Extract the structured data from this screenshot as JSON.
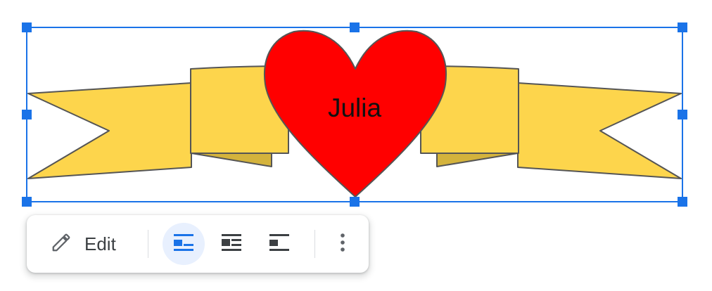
{
  "drawing": {
    "label": "Julia",
    "ribbon_color": "#fdd54c",
    "ribbon_shadow_color": "#d4b33c",
    "heart_color": "#ff0000",
    "selection_color": "#1a73e8"
  },
  "toolbar": {
    "edit_label": "Edit",
    "edit_icon": "pencil-icon",
    "wrap_options": [
      {
        "name": "in-line",
        "icon": "wrap-inline-icon",
        "active": true
      },
      {
        "name": "wrap-text",
        "icon": "wrap-text-icon",
        "active": false
      },
      {
        "name": "break-text",
        "icon": "break-text-icon",
        "active": false
      }
    ],
    "more_icon": "more-vert-icon"
  }
}
